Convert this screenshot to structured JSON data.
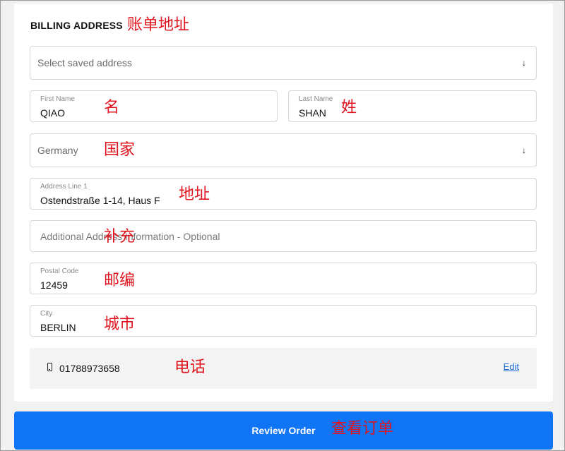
{
  "billing": {
    "title": "BILLING ADDRESS",
    "title_annotation": "账单地址"
  },
  "saved_address": {
    "placeholder": "Select saved address"
  },
  "first_name": {
    "label": "First Name",
    "value": "QIAO",
    "annotation": "名"
  },
  "last_name": {
    "label": "Last Name",
    "value": "SHAN",
    "annotation": "姓"
  },
  "country": {
    "value": "Germany",
    "annotation": "国家"
  },
  "address_line1": {
    "label": "Address Line 1",
    "value": "Ostendstraße 1-14, Haus F",
    "annotation": "地址"
  },
  "additional_info": {
    "placeholder": "Additional Address Information - Optional",
    "annotation": "补充"
  },
  "postal_code": {
    "label": "Postal Code",
    "value": "12459",
    "annotation": "邮编"
  },
  "city": {
    "label": "City",
    "value": "BERLIN",
    "annotation": "城市"
  },
  "phone": {
    "icon": "phone-icon",
    "number": "01788973658",
    "edit_label": "Edit",
    "annotation": "电话"
  },
  "review_button": {
    "label": "Review Order",
    "annotation": "查看订单"
  },
  "colors": {
    "primary_button": "#1075f5",
    "link": "#1e6bdc",
    "annotation": "#e0141e"
  }
}
